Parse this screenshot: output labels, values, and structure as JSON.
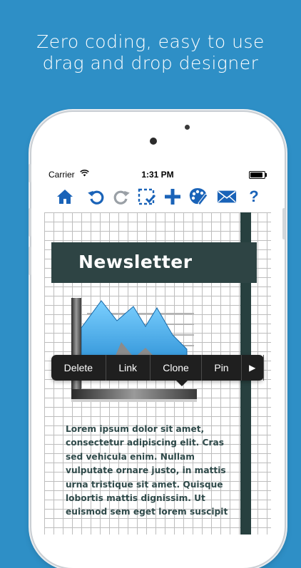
{
  "promo": {
    "headline_line1": "Zero coding, easy to use",
    "headline_line2": "drag and drop designer"
  },
  "statusbar": {
    "carrier": "Carrier",
    "time": "1:31 PM",
    "battery_level": 0.95
  },
  "toolbar": {
    "icons": [
      "home-icon",
      "undo-icon",
      "redo-icon",
      "select-icon",
      "add-icon",
      "palette-icon",
      "email-icon",
      "help-icon"
    ],
    "help_label": "?",
    "accent": "#1a63b8",
    "disabled": "#9aa0a6"
  },
  "document": {
    "banner_title": "Newsletter",
    "body_text": "Lorem ipsum dolor sit amet, consectetur adipiscing elit. Cras sed vehicula enim. Nullam vulputate ornare justo, in mattis urna tristique sit amet. Quisque lobortis mattis dignissim. Ut euismod sem eget lorem suscipit"
  },
  "context_menu": {
    "items": [
      "Delete",
      "Link",
      "Clone",
      "Pin"
    ],
    "more_label": "▶"
  },
  "colors": {
    "background": "#2e8fc6",
    "banner": "#2e4444",
    "chart_blue": "#3fa9e6"
  }
}
